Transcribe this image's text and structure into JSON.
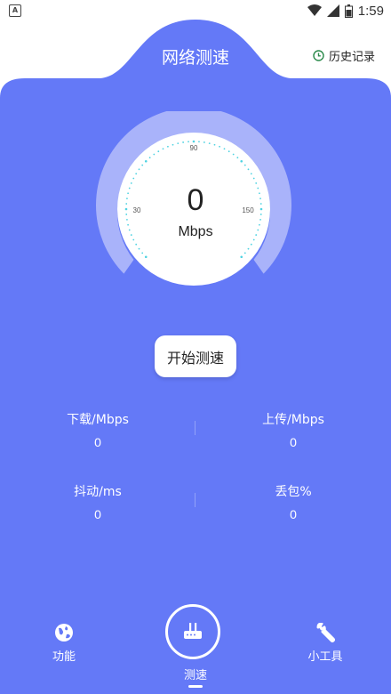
{
  "status_bar": {
    "time": "1:59"
  },
  "header": {
    "title": "网络测速",
    "history_label": "历史记录"
  },
  "gauge": {
    "value": "0",
    "unit": "Mbps",
    "ticks": {
      "left": "30",
      "top": "90",
      "right": "150"
    }
  },
  "start_button": {
    "label": "开始测速"
  },
  "stats": {
    "download": {
      "label": "下载/Mbps",
      "value": "0"
    },
    "upload": {
      "label": "上传/Mbps",
      "value": "0"
    },
    "jitter": {
      "label": "抖动/ms",
      "value": "0"
    },
    "packet_loss": {
      "label": "丢包%",
      "value": "0"
    }
  },
  "bottom_nav": {
    "items": [
      {
        "label": "功能",
        "icon": "globe-icon"
      },
      {
        "label": "测速",
        "icon": "router-icon"
      },
      {
        "label": "小工具",
        "icon": "wrench-icon"
      }
    ]
  },
  "colors": {
    "primary": "#6479F7",
    "gauge_ring": "#A9B3FA",
    "tick": "#4FD3E2"
  }
}
